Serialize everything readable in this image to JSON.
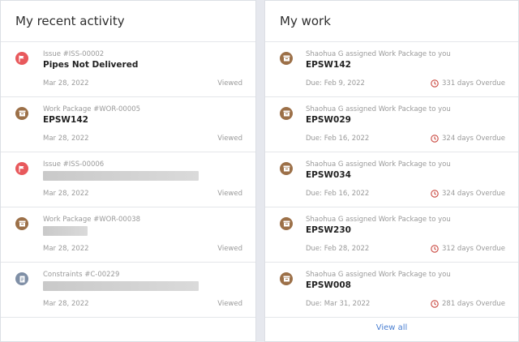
{
  "recent": {
    "heading": "My recent activity",
    "items": [
      {
        "type": "issue",
        "subtitle": "Issue #ISS-00002",
        "title": "Pipes Not Delivered",
        "date": "Mar 28, 2022",
        "status": "Viewed"
      },
      {
        "type": "workpackage",
        "subtitle": "Work Package #WOR-00005",
        "title": "EPSW142",
        "date": "Mar 28, 2022",
        "status": "Viewed"
      },
      {
        "type": "issue",
        "subtitle": "Issue #ISS-00006",
        "title": "",
        "date": "Mar 28, 2022",
        "status": "Viewed"
      },
      {
        "type": "workpackage",
        "subtitle": "Work Package #WOR-00038",
        "title": "",
        "date": "Mar 28, 2022",
        "status": "Viewed"
      },
      {
        "type": "constraint",
        "subtitle": "Constraints #C-00229",
        "title": "",
        "date": "Mar 28, 2022",
        "status": "Viewed"
      }
    ]
  },
  "work": {
    "heading": "My work",
    "items": [
      {
        "subtitle": "Shaohua G assigned Work Package to you",
        "title": "EPSW142",
        "due": "Due: Feb 9, 2022",
        "overdue": "331 days Overdue"
      },
      {
        "subtitle": "Shaohua G assigned Work Package to you",
        "title": "EPSW029",
        "due": "Due: Feb 16, 2022",
        "overdue": "324 days Overdue"
      },
      {
        "subtitle": "Shaohua G assigned Work Package to you",
        "title": "EPSW034",
        "due": "Due: Feb 16, 2022",
        "overdue": "324 days Overdue"
      },
      {
        "subtitle": "Shaohua G assigned Work Package to you",
        "title": "EPSW230",
        "due": "Due: Feb 28, 2022",
        "overdue": "312 days Overdue"
      },
      {
        "subtitle": "Shaohua G assigned Work Package to you",
        "title": "EPSW008",
        "due": "Due: Mar 31, 2022",
        "overdue": "281 days Overdue"
      }
    ],
    "view_all": "View all"
  },
  "icons": {
    "issue": "flag-icon",
    "workpackage": "archive-box-icon",
    "constraint": "document-icon",
    "overdue": "clock-icon"
  },
  "colors": {
    "issue": "#e8595c",
    "workpackage": "#9c7048",
    "constraint": "#7f8fa6",
    "overdue": "#c9473f",
    "link": "#4a7fd1"
  }
}
